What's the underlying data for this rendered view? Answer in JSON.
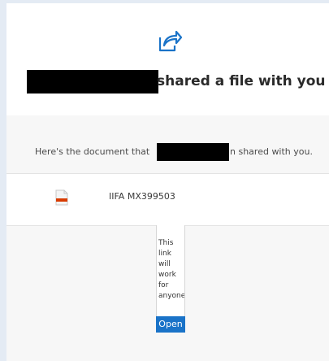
{
  "header": {
    "icon": "share-icon",
    "headline": "shared a file with you"
  },
  "message": {
    "prefix": "Here's the document that",
    "suffix": "n shared with you."
  },
  "file": {
    "icon": "pdf-file-icon",
    "name": "IIFA MX399503"
  },
  "note": "This link will work for anyone.",
  "actions": {
    "open_label": "Open"
  },
  "colors": {
    "accent": "#1a73c8",
    "page_background": "#e4ebf4",
    "pdf_red": "#d83b01"
  }
}
